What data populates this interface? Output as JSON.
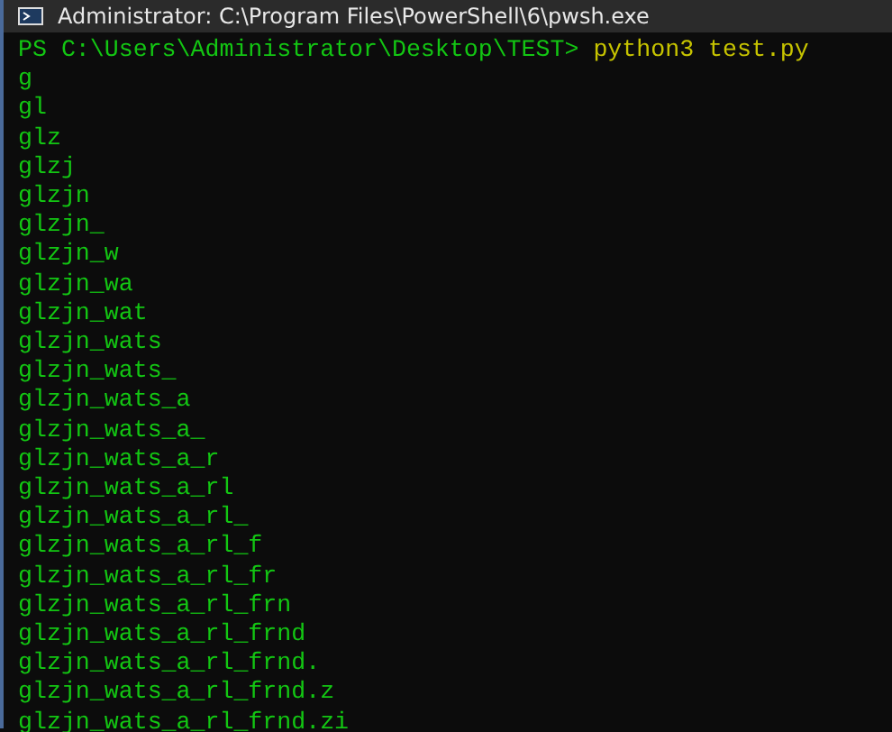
{
  "window": {
    "title": "Administrator: C:\\Program Files\\PowerShell\\6\\pwsh.exe"
  },
  "terminal": {
    "prompt": "PS C:\\Users\\Administrator\\Desktop\\TEST>",
    "command": "python3 test.py",
    "output": [
      "g",
      "gl",
      "glz",
      "glzj",
      "glzjn",
      "glzjn_",
      "glzjn_w",
      "glzjn_wa",
      "glzjn_wat",
      "glzjn_wats",
      "glzjn_wats_",
      "glzjn_wats_a",
      "glzjn_wats_a_",
      "glzjn_wats_a_r",
      "glzjn_wats_a_rl",
      "glzjn_wats_a_rl_",
      "glzjn_wats_a_rl_f",
      "glzjn_wats_a_rl_fr",
      "glzjn_wats_a_rl_frn",
      "glzjn_wats_a_rl_frnd",
      "glzjn_wats_a_rl_frnd.",
      "glzjn_wats_a_rl_frnd.z",
      "glzjn_wats_a_rl_frnd.zi"
    ]
  }
}
